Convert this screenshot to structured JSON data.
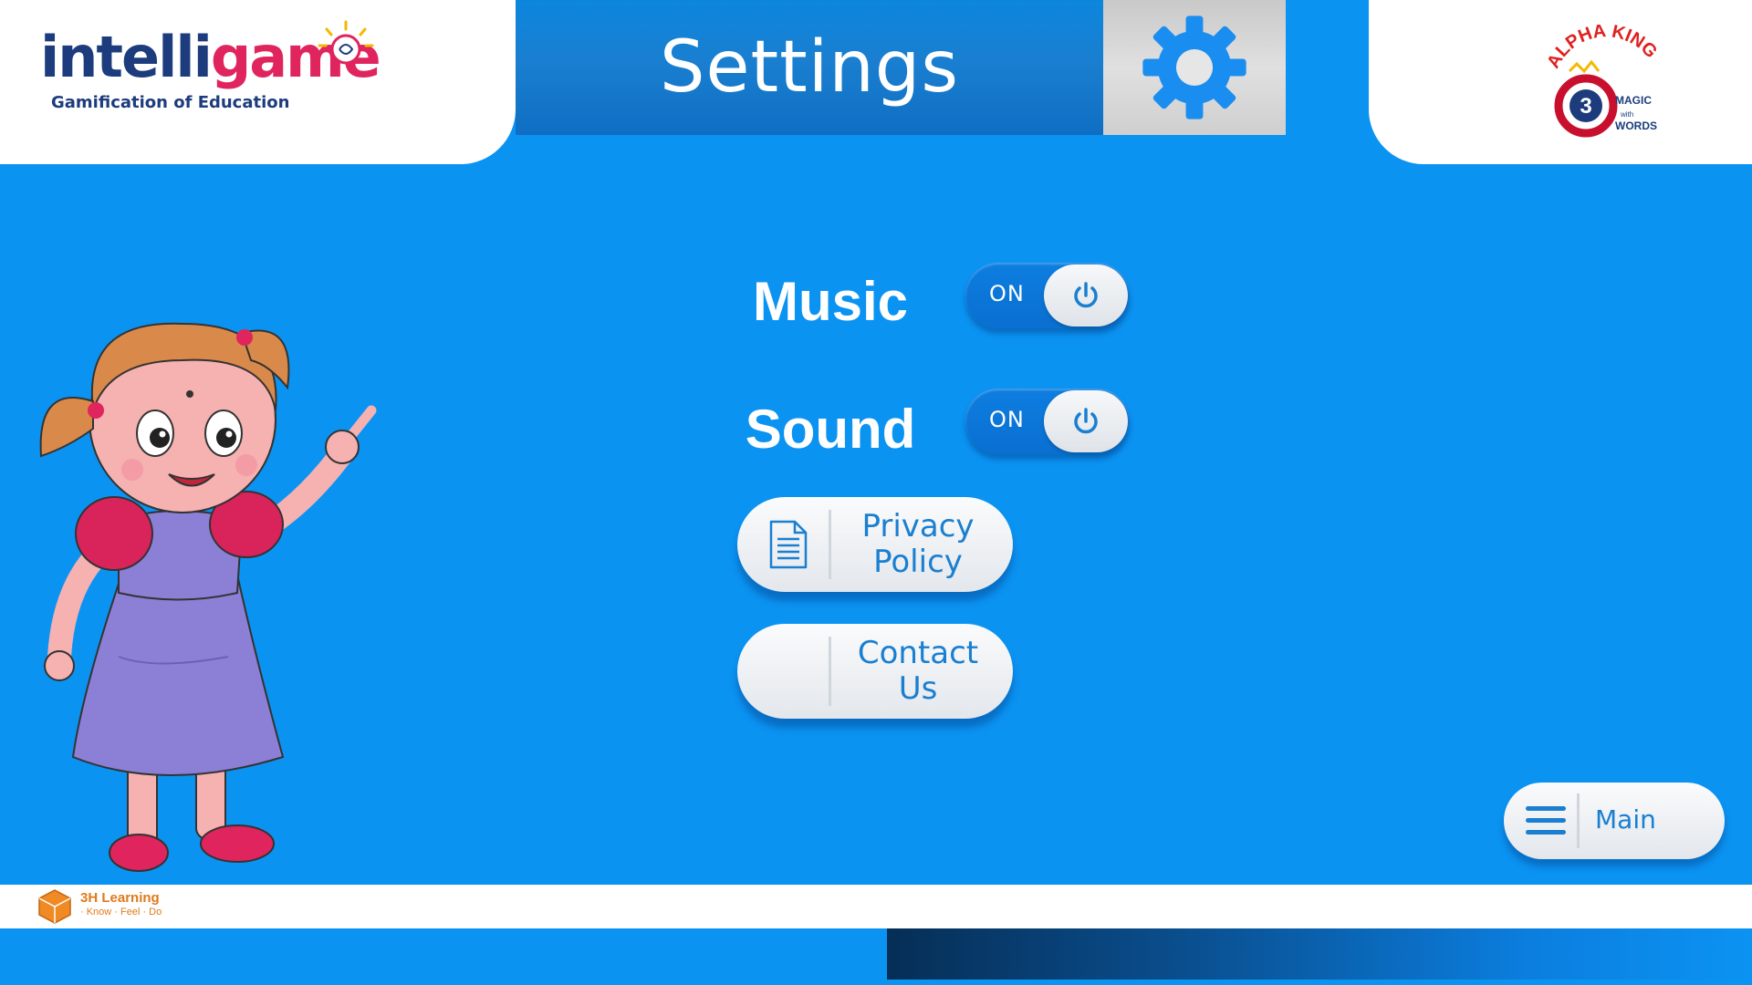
{
  "header": {
    "title": "Settings",
    "gear_icon": "gear-icon"
  },
  "brand_left": {
    "logo_part1": "intelli",
    "logo_part2": "game",
    "tagline": "Gamification of Education"
  },
  "brand_right": {
    "line1": "ALPHA KING",
    "line2": "3",
    "line3": "MAGIC",
    "line4": "with",
    "line5": "WORDS"
  },
  "settings": {
    "music": {
      "label": "Music",
      "state": "ON"
    },
    "sound": {
      "label": "Sound",
      "state": "ON"
    },
    "privacy": {
      "label_line1": "Privacy",
      "label_line2": "Policy",
      "icon": "document-icon"
    },
    "contact": {
      "label_line1": "Contact",
      "label_line2": "Us"
    }
  },
  "nav": {
    "main_label": "Main",
    "main_icon": "hamburger-icon"
  },
  "footer": {
    "brand": "3H Learning",
    "tagline": "· Know · Feel · Do"
  },
  "colors": {
    "background": "#0b93f2",
    "accent": "#1a7fd0",
    "logo_navy": "#1d3c7d",
    "logo_pink": "#e0245e",
    "footer_orange": "#e07a1a"
  }
}
